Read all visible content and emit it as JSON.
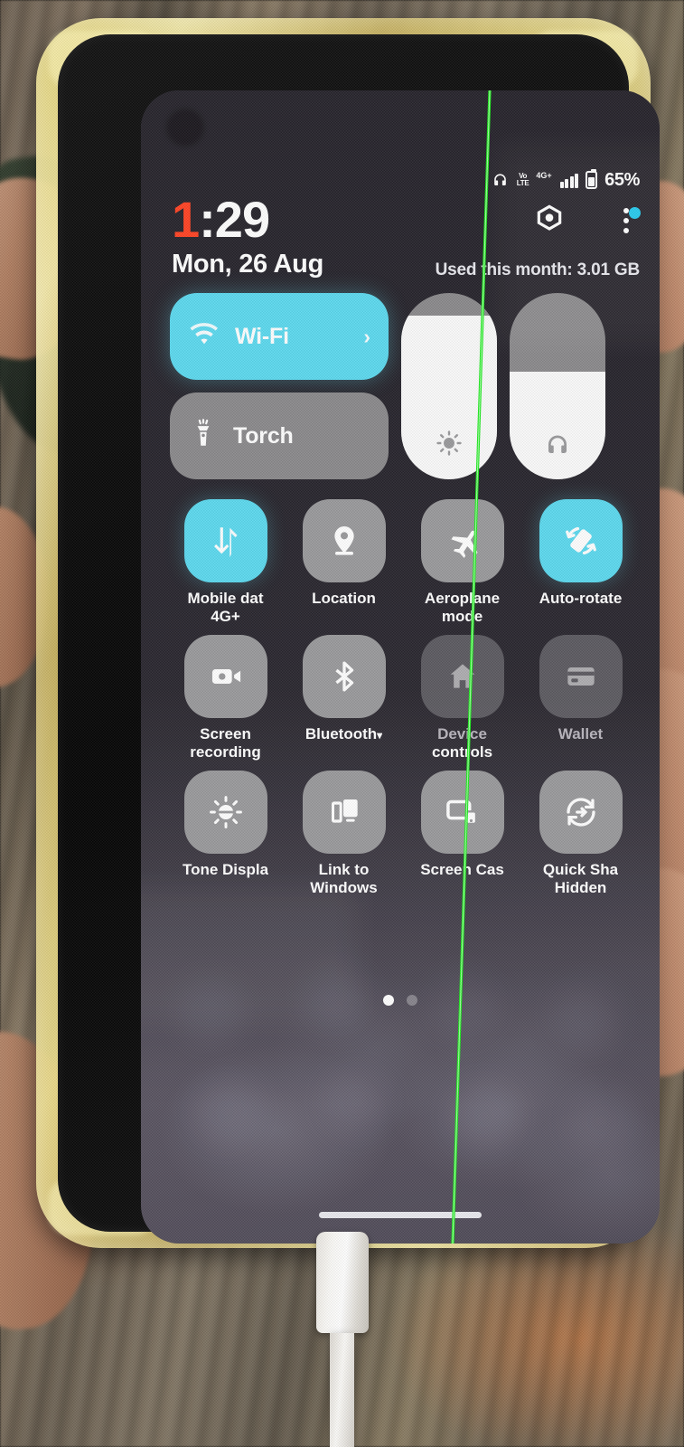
{
  "status_bar": {
    "headphones_icon": "headphones-icon",
    "volte_line1": "Vo",
    "volte_line2": "LTE",
    "network_type": "4G+",
    "signal_icon": "signal-bars-icon",
    "battery_icon": "battery-icon",
    "battery_percent": "65%"
  },
  "header": {
    "time_hour": "1",
    "time_rest": ":29",
    "date": "Mon, 26 Aug",
    "settings_icon": "hex-gear-icon",
    "overflow_icon": "kebab-menu-icon",
    "badge_color": "#22c9ee",
    "data_usage": "Used this month: 3.01 GB"
  },
  "top_tiles": {
    "wifi": {
      "label": "Wi-Fi",
      "icon": "wifi-icon",
      "chevron": "›",
      "state": "on",
      "color": "#5dd9ef"
    },
    "torch": {
      "label": "Torch",
      "icon": "flashlight-icon",
      "state": "off"
    },
    "brightness": {
      "icon": "brightness-icon",
      "value": 88,
      "name": "brightness-slider"
    },
    "volume": {
      "icon": "headphones-icon",
      "value": 58,
      "name": "volume-slider"
    }
  },
  "grid_tiles": [
    {
      "label": "Mobile dat",
      "sublabel": "4G+",
      "icon": "mobile-data-icon",
      "state": "on"
    },
    {
      "label": "Location",
      "sublabel": "",
      "icon": "location-pin-icon",
      "state": "off"
    },
    {
      "label": "Aeroplane",
      "sublabel": "mode",
      "icon": "airplane-icon",
      "state": "off"
    },
    {
      "label": "Auto-rotate",
      "sublabel": "",
      "icon": "auto-rotate-icon",
      "state": "on"
    },
    {
      "label": "Screen",
      "sublabel": "recording",
      "icon": "screen-record-icon",
      "state": "off"
    },
    {
      "label": "Bluetooth",
      "sublabel": "",
      "icon": "bluetooth-icon",
      "state": "off",
      "caret": "▾"
    },
    {
      "label": "Device",
      "sublabel": "controls",
      "icon": "home-icon",
      "state": "dim"
    },
    {
      "label": "Wallet",
      "sublabel": "",
      "icon": "wallet-card-icon",
      "state": "dim"
    },
    {
      "label": "Tone Displa",
      "sublabel": "",
      "icon": "tone-display-icon",
      "state": "off"
    },
    {
      "label": "Link to",
      "sublabel": "Windows",
      "icon": "link-to-windows-icon",
      "state": "off"
    },
    {
      "label": "Screen Cas",
      "sublabel": "",
      "icon": "screen-cast-icon",
      "state": "off"
    },
    {
      "label": "Quick Sha",
      "sublabel": "Hidden",
      "icon": "quick-share-icon",
      "state": "off"
    }
  ],
  "pager": {
    "pages": 2,
    "active": 0
  },
  "gesture_bar": "home-gesture-bar",
  "screen_defect": {
    "name": "green-line-defect",
    "color": "#22ee22"
  },
  "hardware": {
    "case": "yellowed-tpu-case",
    "camera": "punch-hole-camera",
    "cable": "charging-cable"
  }
}
